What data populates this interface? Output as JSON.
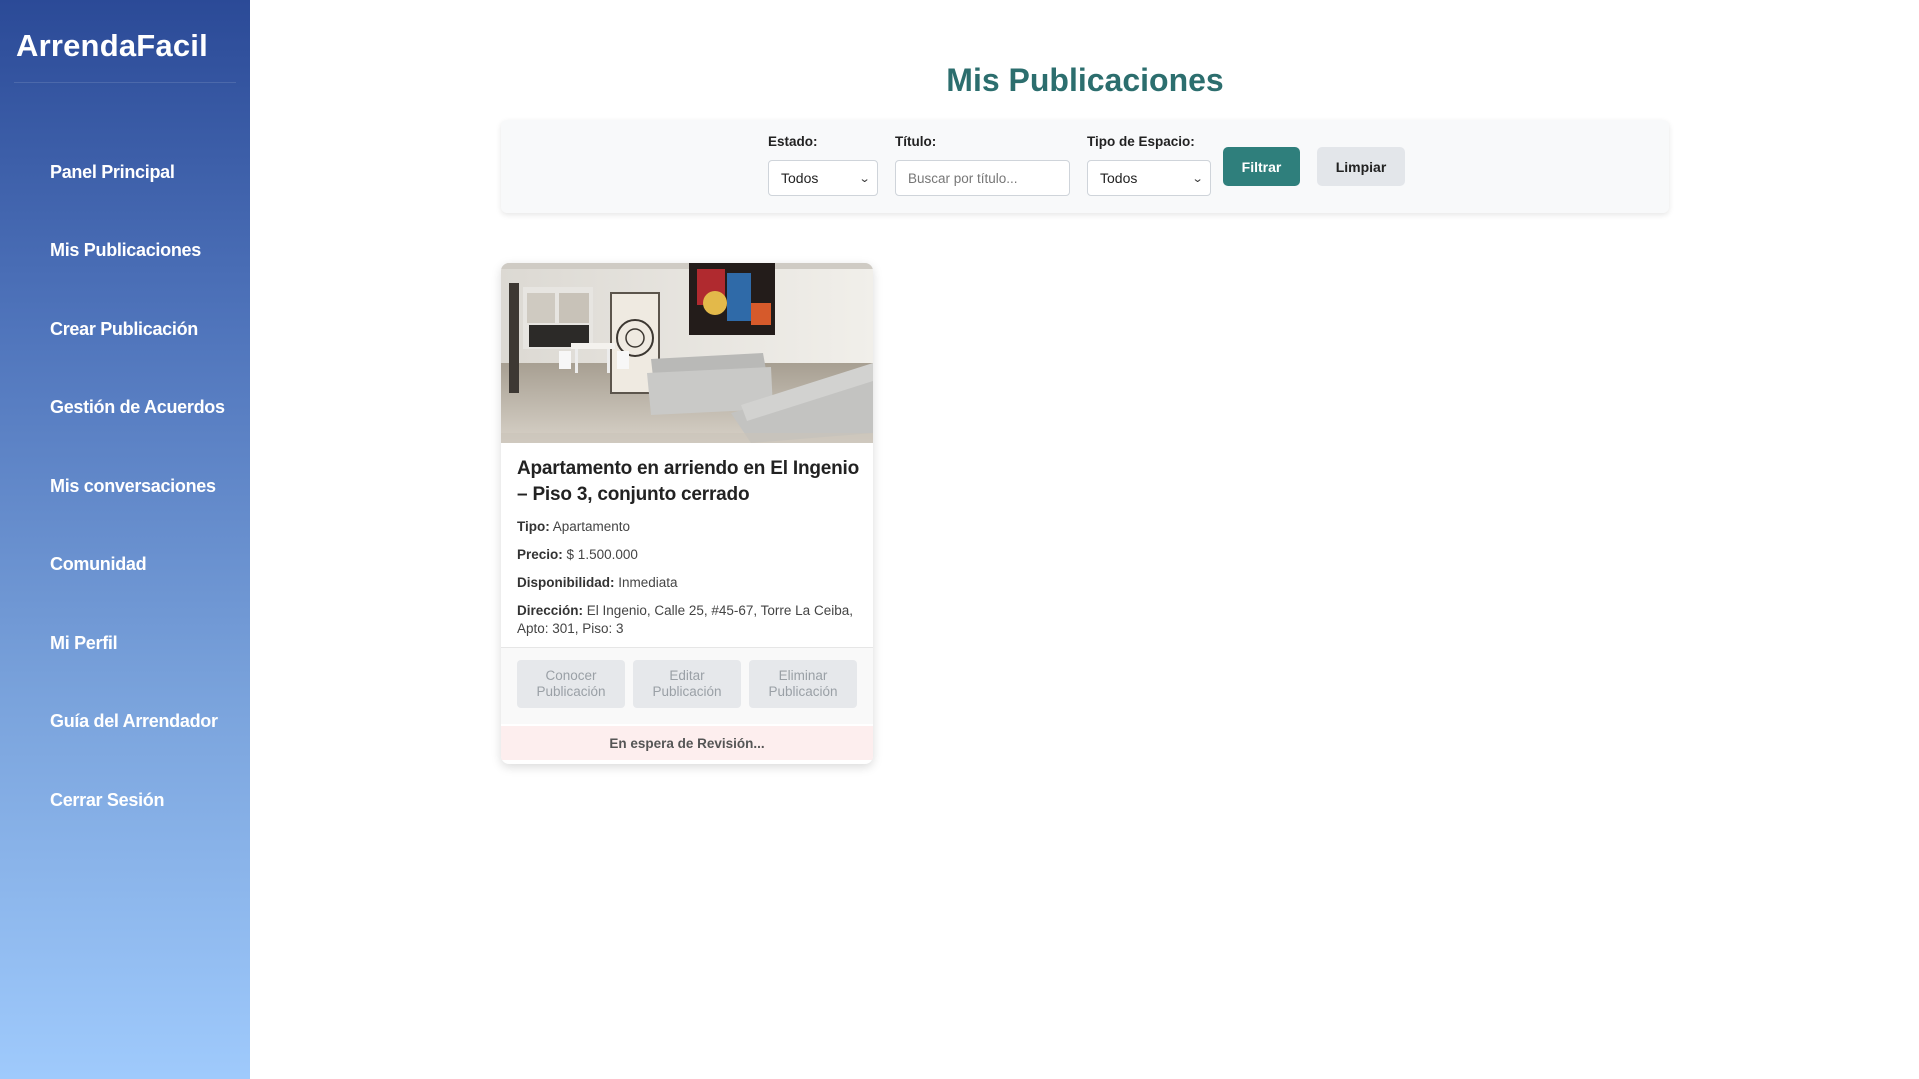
{
  "app": {
    "brand": "ArrendaFacil"
  },
  "sidebar": {
    "items": [
      {
        "label": "Panel Principal"
      },
      {
        "label": "Mis Publicaciones"
      },
      {
        "label": "Crear Publicación"
      },
      {
        "label": "Gestión de Acuerdos"
      },
      {
        "label": "Mis conversaciones"
      },
      {
        "label": "Comunidad"
      },
      {
        "label": "Mi Perfil"
      },
      {
        "label": "Guía del Arrendador"
      },
      {
        "label": "Cerrar Sesión"
      }
    ]
  },
  "main": {
    "title": "Mis Publicaciones"
  },
  "filters": {
    "estado": {
      "label": "Estado:",
      "value": "Todos"
    },
    "titulo": {
      "label": "Título:",
      "placeholder": "Buscar por título..."
    },
    "tipo": {
      "label": "Tipo de Espacio:",
      "value": "Todos"
    },
    "filtrar_label": "Filtrar",
    "limpiar_label": "Limpiar"
  },
  "listings": [
    {
      "title": "Apartamento en arriendo en El Ingenio – Piso 3, conjunto cerrado",
      "tipo_label": "Tipo:",
      "tipo": "Apartamento",
      "precio_label": "Precio:",
      "precio": "$ 1.500.000",
      "disponibilidad_label": "Disponibilidad:",
      "disponibilidad": "Inmediata",
      "direccion_label": "Dirección:",
      "direccion": "El Ingenio, Calle 25, #45-67, Torre La Ceiba, Apto: 301, Piso: 3",
      "actions": {
        "conocer": "Conocer Publicación",
        "editar": "Editar Publicación",
        "eliminar": "Eliminar Publicación"
      },
      "status": "En espera de Revisión..."
    }
  ],
  "colors": {
    "accent": "#2f7f7c",
    "title": "#2c6e6e",
    "sidebar_top": "#2b4a97",
    "sidebar_bottom": "#9fcafc",
    "status_bg": "#fdeeee"
  },
  "icons": {
    "select_arrow": "chevron-down-icon"
  }
}
